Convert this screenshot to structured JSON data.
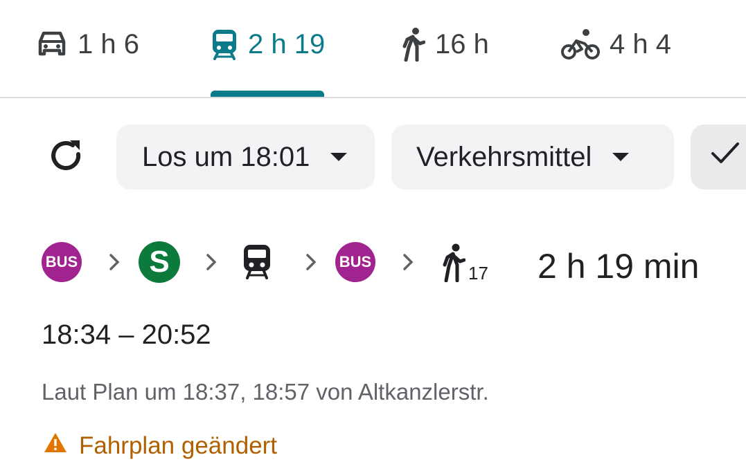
{
  "tabs": [
    {
      "mode": "car-icon",
      "label": "1 h 6",
      "active": false
    },
    {
      "mode": "train-icon",
      "label": "2 h 19",
      "active": true
    },
    {
      "mode": "walk-icon",
      "label": "16 h",
      "active": false
    },
    {
      "mode": "bicycle-icon",
      "label": "4 h 4",
      "active": false
    }
  ],
  "filters": {
    "refresh_icon": "refresh-icon",
    "departure_label": "Los um 18:01",
    "modes_label": "Verkehrsmittel",
    "check_icon": "check-icon"
  },
  "route": {
    "steps": [
      {
        "type": "bus",
        "label": "BUS",
        "color": "#a0238f"
      },
      {
        "type": "sbahn",
        "label": "S",
        "color": "#0b7a3a"
      },
      {
        "type": "train",
        "icon": "train-icon"
      },
      {
        "type": "bus",
        "label": "BUS",
        "color": "#a0238f"
      },
      {
        "type": "walk",
        "icon": "walk-icon",
        "minutes": "17"
      }
    ],
    "duration": "2 h 19 min",
    "times": "18:34 – 20:52",
    "schedule_note": "Laut Plan um 18:37, 18:57 von Altkanzlerstr.",
    "warning": "Fahrplan geändert",
    "warning_color": "#b06000"
  },
  "colors": {
    "accent": "#0b7b8a"
  }
}
